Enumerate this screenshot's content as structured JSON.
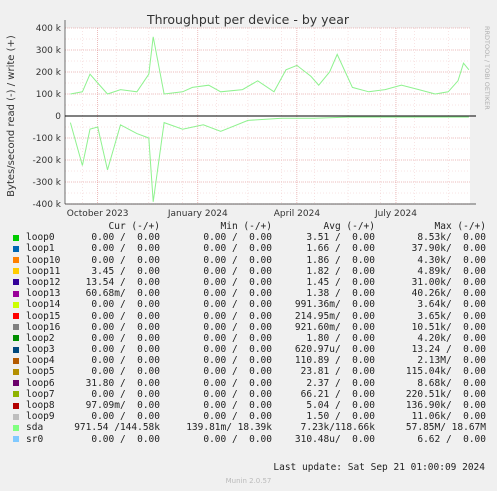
{
  "chart_data": {
    "type": "line",
    "title": "Throughput per device - by year",
    "ylabel": "Bytes/second read (-) / write (+)",
    "side_label": "RRDTOOL / TOBI OETIKER",
    "ylim": [
      -400000,
      400000
    ],
    "yticks": [
      {
        "value": 400000,
        "label": "400 k"
      },
      {
        "value": 300000,
        "label": "300 k"
      },
      {
        "value": 200000,
        "label": "200 k"
      },
      {
        "value": 100000,
        "label": "100 k"
      },
      {
        "value": 0,
        "label": "0"
      },
      {
        "value": -100000,
        "label": "-100 k"
      },
      {
        "value": -200000,
        "label": "-200 k"
      },
      {
        "value": -300000,
        "label": "-300 k"
      },
      {
        "value": -400000,
        "label": "-400 k"
      }
    ],
    "x_range": [
      "2023-09-15",
      "2024-09-21"
    ],
    "xticks": [
      {
        "date": "2023-10-15",
        "label": "October 2023"
      },
      {
        "date": "2024-01-15",
        "label": "January 2024"
      },
      {
        "date": "2024-04-15",
        "label": "April 2024"
      },
      {
        "date": "2024-07-15",
        "label": "July 2024"
      }
    ],
    "grid": true,
    "series": [
      {
        "name": "sda (write)",
        "color": "#8ff28f",
        "x": [
          "2023-09-20",
          "2023-10-01",
          "2023-10-08",
          "2023-10-15",
          "2023-10-24",
          "2023-11-05",
          "2023-11-20",
          "2023-12-01",
          "2023-12-05",
          "2023-12-15",
          "2024-01-01",
          "2024-01-10",
          "2024-01-25",
          "2024-02-05",
          "2024-02-25",
          "2024-03-10",
          "2024-03-25",
          "2024-04-05",
          "2024-04-15",
          "2024-04-28",
          "2024-05-05",
          "2024-05-15",
          "2024-05-22",
          "2024-06-05",
          "2024-06-20",
          "2024-07-05",
          "2024-07-20",
          "2024-08-05",
          "2024-08-20",
          "2024-09-01",
          "2024-09-10",
          "2024-09-15",
          "2024-09-20"
        ],
        "values": [
          100000,
          110000,
          190000,
          150000,
          100000,
          120000,
          110000,
          190000,
          360000,
          100000,
          110000,
          130000,
          140000,
          110000,
          120000,
          160000,
          110000,
          210000,
          230000,
          180000,
          140000,
          200000,
          280000,
          130000,
          110000,
          120000,
          140000,
          120000,
          100000,
          110000,
          160000,
          240000,
          210000
        ]
      },
      {
        "name": "sda (read)",
        "color": "#8ff28f",
        "x": [
          "2023-09-20",
          "2023-10-01",
          "2023-10-08",
          "2023-10-15",
          "2023-10-24",
          "2023-11-05",
          "2023-11-20",
          "2023-12-01",
          "2023-12-05",
          "2023-12-15",
          "2024-01-01",
          "2024-01-20",
          "2024-02-05",
          "2024-03-01",
          "2024-04-01",
          "2024-05-01",
          "2024-06-01",
          "2024-07-01",
          "2024-08-01",
          "2024-09-01",
          "2024-09-20"
        ],
        "values": [
          -30000,
          -225000,
          -60000,
          -50000,
          -245000,
          -40000,
          -80000,
          -100000,
          -390000,
          -30000,
          -60000,
          -40000,
          -70000,
          -20000,
          -10000,
          -10000,
          -5000,
          -5000,
          -5000,
          -5000,
          -5000
        ]
      }
    ]
  },
  "legend": {
    "headers": {
      "cur": "Cur (-/+)",
      "min": "Min (-/+)",
      "avg": "Avg (-/+)",
      "max": "Max (-/+)"
    },
    "rows": [
      {
        "name": "loop0",
        "color": "#00cc00",
        "cur": "0.00 /  0.00",
        "min": "0.00 /  0.00",
        "avg": "3.51 /  0.00",
        "max": "8.53k/  0.00"
      },
      {
        "name": "loop1",
        "color": "#0066b3",
        "cur": "0.00 /  0.00",
        "min": "0.00 /  0.00",
        "avg": "1.66 /  0.00",
        "max": "37.90k/  0.00"
      },
      {
        "name": "loop10",
        "color": "#ff8000",
        "cur": "0.00 /  0.00",
        "min": "0.00 /  0.00",
        "avg": "1.86 /  0.00",
        "max": "4.30k/  0.00"
      },
      {
        "name": "loop11",
        "color": "#ffcc00",
        "cur": "3.45 /  0.00",
        "min": "0.00 /  0.00",
        "avg": "1.82 /  0.00",
        "max": "4.89k/  0.00"
      },
      {
        "name": "loop12",
        "color": "#330099",
        "cur": "13.54 /  0.00",
        "min": "0.00 /  0.00",
        "avg": "1.45 /  0.00",
        "max": "31.00k/  0.00"
      },
      {
        "name": "loop13",
        "color": "#990099",
        "cur": "60.68m/  0.00",
        "min": "0.00 /  0.00",
        "avg": "1.38 /  0.00",
        "max": "40.26k/  0.00"
      },
      {
        "name": "loop14",
        "color": "#ccff00",
        "cur": "0.00 /  0.00",
        "min": "0.00 /  0.00",
        "avg": "991.36m/  0.00",
        "max": "3.64k/  0.00"
      },
      {
        "name": "loop15",
        "color": "#ff0000",
        "cur": "0.00 /  0.00",
        "min": "0.00 /  0.00",
        "avg": "214.95m/  0.00",
        "max": "3.65k/  0.00"
      },
      {
        "name": "loop16",
        "color": "#808080",
        "cur": "0.00 /  0.00",
        "min": "0.00 /  0.00",
        "avg": "921.60m/  0.00",
        "max": "10.51k/  0.00"
      },
      {
        "name": "loop2",
        "color": "#008f00",
        "cur": "0.00 /  0.00",
        "min": "0.00 /  0.00",
        "avg": "1.80 /  0.00",
        "max": "4.20k/  0.00"
      },
      {
        "name": "loop3",
        "color": "#00487d",
        "cur": "0.00 /  0.00",
        "min": "0.00 /  0.00",
        "avg": "620.97u/  0.00",
        "max": "13.24 /  0.00"
      },
      {
        "name": "loop4",
        "color": "#b35a00",
        "cur": "0.00 /  0.00",
        "min": "0.00 /  0.00",
        "avg": "110.89 /  0.00",
        "max": "2.13M/  0.00"
      },
      {
        "name": "loop5",
        "color": "#b38f00",
        "cur": "0.00 /  0.00",
        "min": "0.00 /  0.00",
        "avg": "23.81 /  0.00",
        "max": "115.04k/  0.00"
      },
      {
        "name": "loop6",
        "color": "#6b006b",
        "cur": "31.80 /  0.00",
        "min": "0.00 /  0.00",
        "avg": "2.37 /  0.00",
        "max": "8.68k/  0.00"
      },
      {
        "name": "loop7",
        "color": "#8fb300",
        "cur": "0.00 /  0.00",
        "min": "0.00 /  0.00",
        "avg": "66.21 /  0.00",
        "max": "220.51k/  0.00"
      },
      {
        "name": "loop8",
        "color": "#b30000",
        "cur": "97.09m/  0.00",
        "min": "0.00 /  0.00",
        "avg": "5.04 /  0.00",
        "max": "136.90k/  0.00"
      },
      {
        "name": "loop9",
        "color": "#bebebe",
        "cur": "0.00 /  0.00",
        "min": "0.00 /  0.00",
        "avg": "1.50 /  0.00",
        "max": "11.06k/  0.00"
      },
      {
        "name": "sda",
        "color": "#80ff80",
        "cur": "971.54 /144.58k",
        "min": "139.81m/ 18.39k",
        "avg": "7.23k/118.66k",
        "max": "57.85M/ 18.67M"
      },
      {
        "name": "sr0",
        "color": "#80c9ff",
        "cur": "0.00 /  0.00",
        "min": "0.00 /  0.00",
        "avg": "310.48u/  0.00",
        "max": "6.62 /  0.00"
      }
    ]
  },
  "footer": {
    "last_update": "Last update: Sat Sep 21 01:00:09 2024",
    "version": "Munin 2.0.57"
  }
}
